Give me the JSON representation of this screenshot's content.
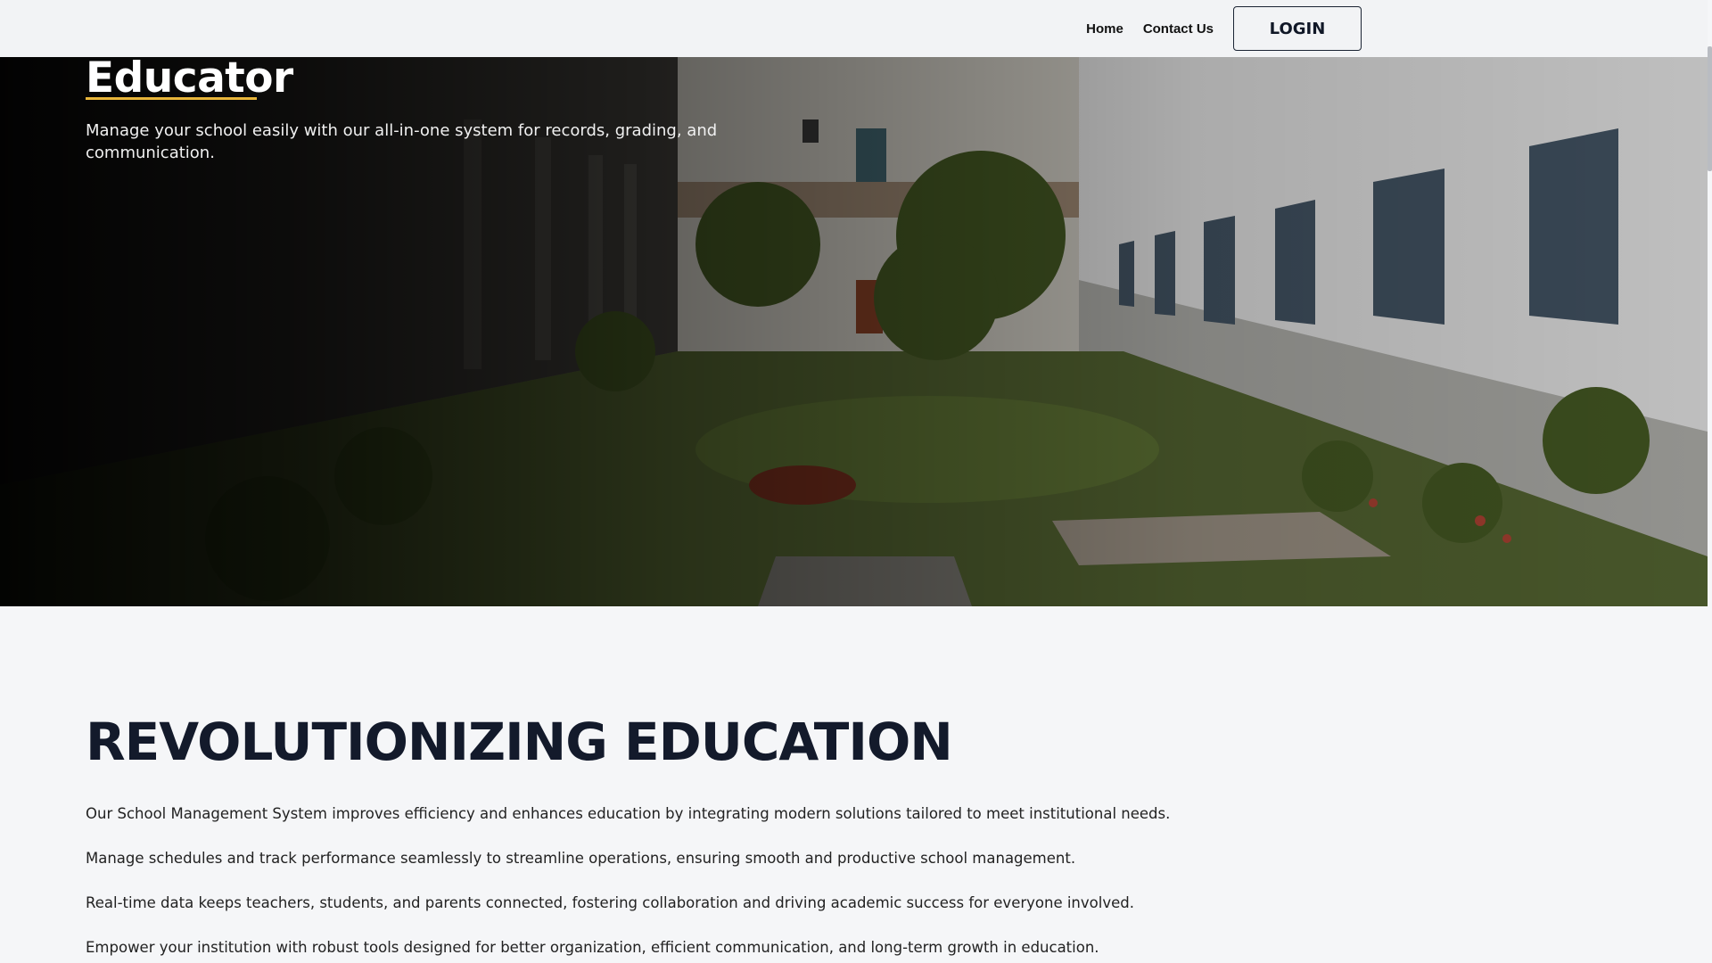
{
  "header": {
    "nav": [
      {
        "label": "Home"
      },
      {
        "label": "Contact Us"
      }
    ],
    "login_label": "LOGIN"
  },
  "hero": {
    "title": "Educator",
    "subtitle": "Manage your school easily with our all-in-one system for records, grading, and communication.",
    "accent_color": "#e8b53a"
  },
  "section": {
    "title": "REVOLUTIONIZING EDUCATION",
    "paragraphs": [
      "Our School Management System improves efficiency and enhances education by integrating modern solutions tailored to meet institutional needs.",
      "Manage schedules and track performance seamlessly to streamline operations, ensuring smooth and productive school management.",
      "Real-time data keeps teachers, students, and parents connected, fostering collaboration and driving academic success for everyone involved.",
      "Empower your institution with robust tools designed for better organization, efficient communication, and long-term growth in education."
    ]
  }
}
